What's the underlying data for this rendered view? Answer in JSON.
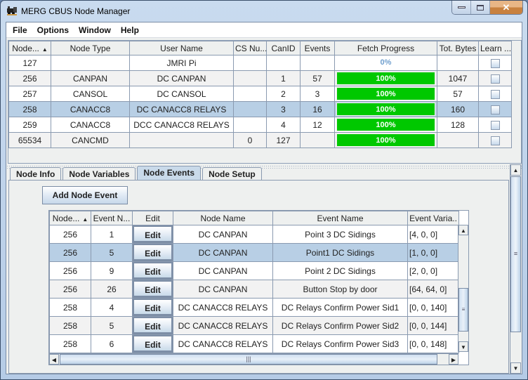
{
  "window": {
    "title": "MERG CBUS Node Manager",
    "controls": {
      "minimize": "minimize",
      "maximize": "maximize",
      "close": "✕"
    }
  },
  "menu": [
    "File",
    "Options",
    "Window",
    "Help"
  ],
  "node_table": {
    "columns": [
      "Node...",
      "Node Type",
      "User Name",
      "CS Nu...",
      "CanID",
      "Events",
      "Fetch Progress",
      "Tot. Bytes",
      "Learn ..."
    ],
    "sort_indicator": "▲",
    "rows": [
      {
        "node": "127",
        "type": "",
        "user": "JMRI Pi",
        "cs": "",
        "canid": "",
        "events": "",
        "progress": "0%",
        "progress_value": 0,
        "bytes": "",
        "learn": false
      },
      {
        "node": "256",
        "type": "CANPAN",
        "user": "DC CANPAN",
        "cs": "",
        "canid": "1",
        "events": "57",
        "progress": "100%",
        "progress_value": 100,
        "bytes": "1047",
        "learn": false
      },
      {
        "node": "257",
        "type": "CANSOL",
        "user": "DC CANSOL",
        "cs": "",
        "canid": "2",
        "events": "3",
        "progress": "100%",
        "progress_value": 100,
        "bytes": "57",
        "learn": false
      },
      {
        "node": "258",
        "type": "CANACC8",
        "user": "DC CANACC8 RELAYS",
        "cs": "",
        "canid": "3",
        "events": "16",
        "progress": "100%",
        "progress_value": 100,
        "bytes": "160",
        "learn": false,
        "selected": true
      },
      {
        "node": "259",
        "type": "CANACC8",
        "user": "DCC CANACC8 RELAYS",
        "cs": "",
        "canid": "4",
        "events": "12",
        "progress": "100%",
        "progress_value": 100,
        "bytes": "128",
        "learn": false
      },
      {
        "node": "65534",
        "type": "CANCMD",
        "user": "",
        "cs": "0",
        "canid": "127",
        "events": "",
        "progress": "100%",
        "progress_value": 100,
        "bytes": "",
        "learn": false
      }
    ],
    "progress_color": "#00c800",
    "selected_row_color": "#b8cfe5"
  },
  "tabs": [
    {
      "label": "Node Info",
      "active": false
    },
    {
      "label": "Node Variables",
      "active": false
    },
    {
      "label": "Node Events",
      "active": true
    },
    {
      "label": "Node Setup",
      "active": false
    }
  ],
  "node_events": {
    "add_button": "Add Node Event",
    "columns": [
      "Node...",
      "Event N...",
      "Edit",
      "Node Name",
      "Event Name",
      "Event Varia.."
    ],
    "sort_indicator": "▲",
    "edit_label": "Edit",
    "rows": [
      {
        "node": "256",
        "event": "1",
        "node_name": "DC CANPAN",
        "event_name": "Point 3 DC Sidings",
        "vars": "[4, 0, 0]"
      },
      {
        "node": "256",
        "event": "5",
        "node_name": "DC CANPAN",
        "event_name": "Point1 DC Sidings",
        "vars": "[1, 0, 0]",
        "selected": true
      },
      {
        "node": "256",
        "event": "9",
        "node_name": "DC CANPAN",
        "event_name": "Point 2 DC Sidings",
        "vars": "[2, 0, 0]"
      },
      {
        "node": "256",
        "event": "26",
        "node_name": "DC CANPAN",
        "event_name": "Button Stop by door",
        "vars": "[64, 64, 0]"
      },
      {
        "node": "258",
        "event": "4",
        "node_name": "DC CANACC8 RELAYS",
        "event_name": "DC Relays Confirm Power Sid1",
        "vars": "[0, 0, 140]"
      },
      {
        "node": "258",
        "event": "5",
        "node_name": "DC CANACC8 RELAYS",
        "event_name": "DC Relays Confirm Power Sid2",
        "vars": "[0, 0, 144]"
      },
      {
        "node": "258",
        "event": "6",
        "node_name": "DC CANACC8 RELAYS",
        "event_name": "DC Relays Confirm Power Sid3",
        "vars": "[0, 0, 148]"
      }
    ]
  },
  "icons": {
    "scroll_up": "▲",
    "scroll_down": "▼",
    "scroll_left": "◀",
    "scroll_right": "▶",
    "grip_v": "≡",
    "grip_h": "|||"
  }
}
